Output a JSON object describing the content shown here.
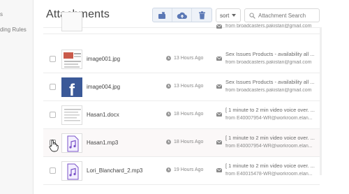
{
  "sidebar": {
    "items": [
      {
        "label": "s"
      },
      {
        "label": "ding Rules"
      }
    ]
  },
  "header": {
    "title": "Attachments"
  },
  "toolbar": {
    "sort_label": "sort",
    "search_placeholder": "Attachment Search"
  },
  "rows": [
    {
      "filename": "",
      "time": "",
      "subject": "",
      "from": "from broadcasters.pakistan@gmail.com",
      "checked": false
    },
    {
      "filename": "image001.jpg",
      "time": "13 Hours Ago",
      "subject": "Sex Issues Products - availability all ...",
      "from": "from broadcasters.pakistan@gmail.com",
      "checked": false
    },
    {
      "filename": "image004.jpg",
      "time": "13 Hours Ago",
      "subject": "Sex Issues Products - availability all ...",
      "from": "from broadcasters.pakistan@gmail.com",
      "checked": false
    },
    {
      "filename": "Hasan1.docx",
      "time": "18 Hours Ago",
      "subject": "[ 1 minute to 2 min video voice over. ...",
      "from": "from E40007954-WR@workroom.elan...",
      "checked": false
    },
    {
      "filename": "Hasan1.mp3",
      "time": "18 Hours Ago",
      "subject": "[ 1 minute to 2 min video voice over. ...",
      "from": "from E40007954-WR@workroom.elan...",
      "checked": true
    },
    {
      "filename": "Lori_Blanchard_2.mp3",
      "time": "19 Hours Ago",
      "subject": "[ 1 minute to 2 min video voice over. ...",
      "from": "from E40015478-WR@workroom.elan...",
      "checked": false
    }
  ],
  "colors": {
    "accent": "#5b78b5",
    "purple": "#7a52c7",
    "facebook": "#3b5998"
  }
}
